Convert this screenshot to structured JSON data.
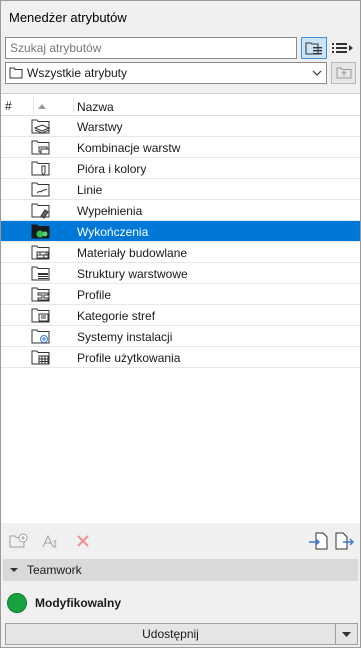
{
  "window": {
    "title": "Menedżer atrybutów"
  },
  "search": {
    "placeholder": "Szukaj atrybutów"
  },
  "filter": {
    "selected": "Wszystkie atrybuty"
  },
  "list": {
    "header": {
      "hash": "#",
      "name": "Nazwa"
    },
    "items": [
      {
        "label": "Warstwy",
        "icon": "layers-folder-icon"
      },
      {
        "label": "Kombinacje warstw",
        "icon": "layer-combinations-folder-icon"
      },
      {
        "label": "Pióra i kolory",
        "icon": "pens-colors-folder-icon"
      },
      {
        "label": "Linie",
        "icon": "lines-folder-icon"
      },
      {
        "label": "Wypełnienia",
        "icon": "fills-folder-icon"
      },
      {
        "label": "Wykończenia",
        "icon": "surfaces-folder-icon",
        "selected": true
      },
      {
        "label": "Materiały budowlane",
        "icon": "building-materials-folder-icon"
      },
      {
        "label": "Struktury warstwowe",
        "icon": "composites-folder-icon"
      },
      {
        "label": "Profile",
        "icon": "profiles-folder-icon"
      },
      {
        "label": "Kategorie stref",
        "icon": "zone-categories-folder-icon"
      },
      {
        "label": "Systemy instalacji",
        "icon": "mep-systems-folder-icon"
      },
      {
        "label": "Profile użytkowania",
        "icon": "operation-profiles-folder-icon"
      }
    ]
  },
  "teamwork": {
    "label": "Teamwork",
    "status": "Modyfikowalny",
    "share_label": "Udostępnij"
  },
  "colors": {
    "selection": "#0078d7",
    "status_green": "#19a240"
  }
}
